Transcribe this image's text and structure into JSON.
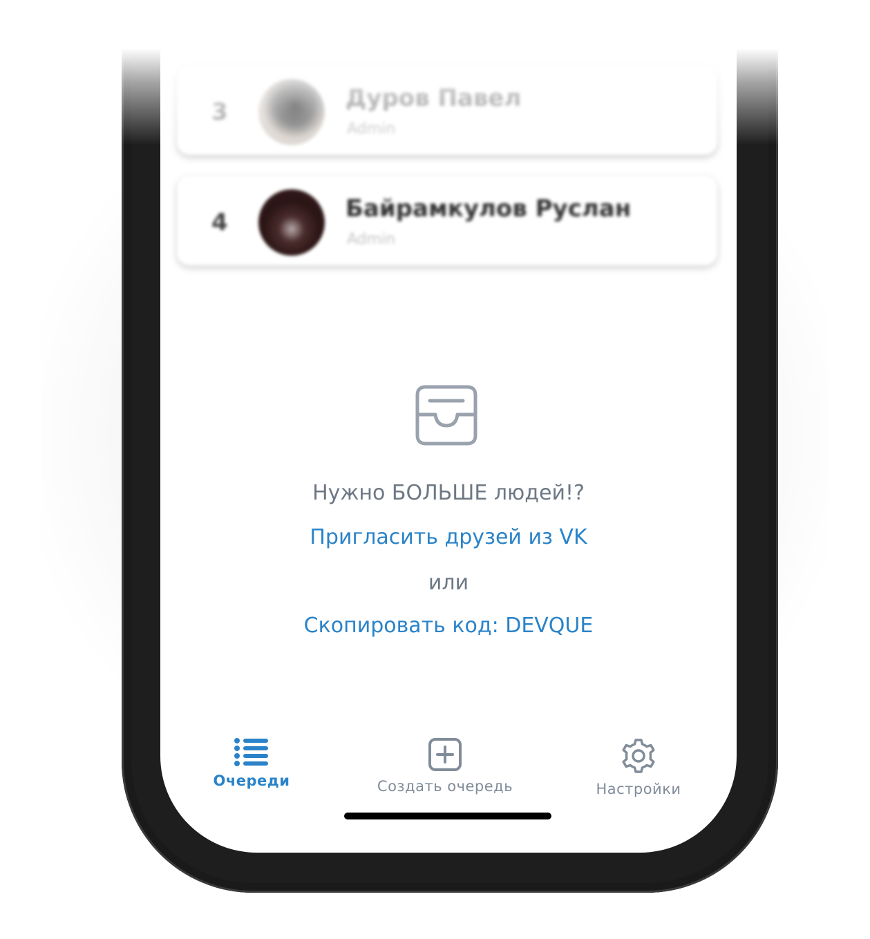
{
  "members": [
    {
      "position": "3",
      "name": "Дуров Павел",
      "role": "Admin"
    },
    {
      "position": "4",
      "name": "Байрамкулов Руслан",
      "role": "Admin"
    }
  ],
  "empty_state": {
    "icon": "inbox-icon",
    "prompt": "Нужно БОЛЬШЕ людей!?",
    "invite_link": "Пригласить друзей из VK",
    "or_text": "или",
    "copy_code_link": "Скопировать код: DEVQUE"
  },
  "tabbar": {
    "tabs": [
      {
        "label": "Очереди",
        "icon": "list-icon",
        "active": true
      },
      {
        "label": "Создать очередь",
        "icon": "add-square-icon",
        "active": false
      },
      {
        "label": "Настройки",
        "icon": "gear-icon",
        "active": false
      }
    ]
  },
  "colors": {
    "accent": "#2a83c8",
    "secondary_text": "#6d7885",
    "inactive_tab": "#818c99",
    "phone_frame": "#1e1e1e"
  }
}
